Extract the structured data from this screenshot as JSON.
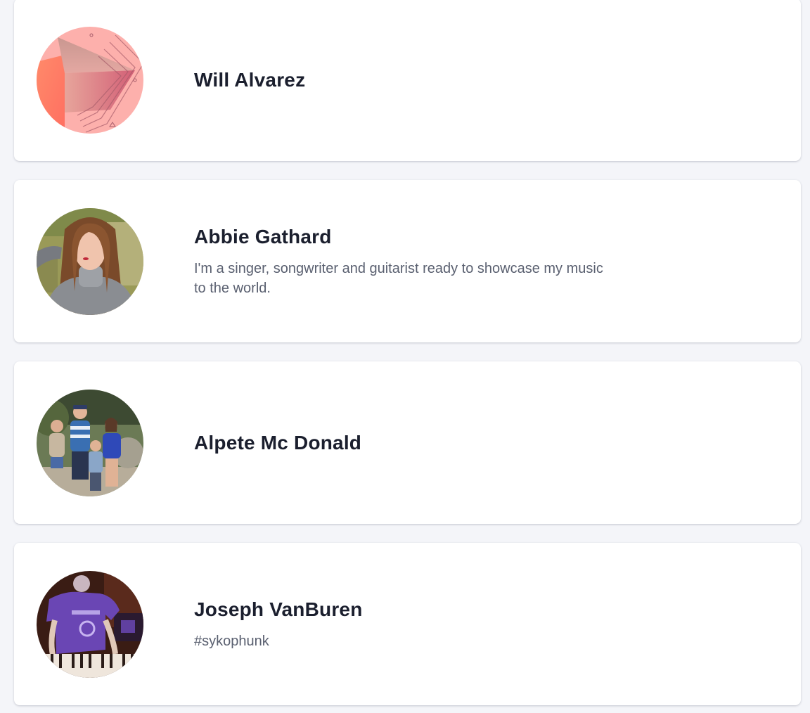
{
  "users": [
    {
      "name": "Will Alvarez",
      "bio": "",
      "avatar_icon": "abstract-geometric-art-avatar"
    },
    {
      "name": "Abbie Gathard",
      "bio": "I'm a singer, songwriter and guitarist ready to showcase my music to the world.",
      "avatar_icon": "portrait-photo-avatar"
    },
    {
      "name": "Alpete Mc Donald",
      "bio": "",
      "avatar_icon": "family-photo-avatar"
    },
    {
      "name": "Joseph VanBuren",
      "bio": "#sykophunk",
      "avatar_icon": "musician-at-keyboard-photo-avatar"
    }
  ],
  "colors": {
    "page_background": "#f4f5f9",
    "card_background": "#ffffff",
    "name_text": "#1b1f2e",
    "bio_text": "#5a6070"
  }
}
